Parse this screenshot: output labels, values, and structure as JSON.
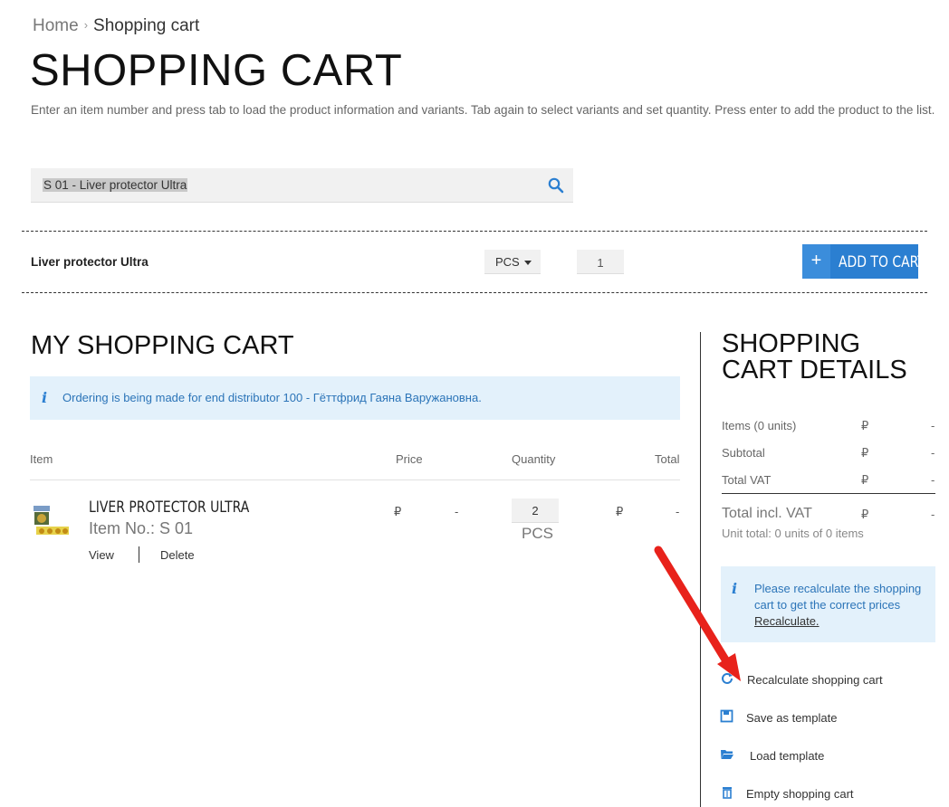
{
  "breadcrumb": {
    "home": "Home",
    "separator": "›",
    "current": "Shopping cart"
  },
  "page": {
    "title": "SHOPPING CART",
    "intro": "Enter an item number and press tab to load the product information and variants. Tab again to select variants and set quantity. Press enter to add the product to the list."
  },
  "search": {
    "value": "S 01 - Liver protector Ultra",
    "icon": "search-icon"
  },
  "quick_add": {
    "product_name": "Liver protector Ultra",
    "unit": "PCS",
    "quantity": "1",
    "add_plus": "+",
    "add_label": "ADD TO CART"
  },
  "my_cart": {
    "title": "MY SHOPPING CART",
    "info_icon": "i",
    "info_text": "Ordering is being made for end distributor 100 - Гёттфрид Гаяна Варужановна.",
    "columns": {
      "item": "Item",
      "price": "Price",
      "quantity": "Quantity",
      "total": "Total"
    },
    "items": [
      {
        "name": "LIVER PROTECTOR ULTRA",
        "item_no": "Item No.: S 01",
        "price_currency": "₽",
        "price_value": "-",
        "quantity": "2",
        "unit": "PCS",
        "total_currency": "₽",
        "total_value": "-",
        "view_label": "View",
        "delete_label": "Delete"
      }
    ]
  },
  "details": {
    "title_line1": "SHOPPING",
    "title_line2": "CART DETAILS",
    "rows": [
      {
        "label": "Items (0 units)",
        "currency": "₽",
        "value": "-"
      },
      {
        "label": "Subtotal",
        "currency": "₽",
        "value": "-"
      },
      {
        "label": "Total VAT",
        "currency": "₽",
        "value": "-"
      }
    ],
    "total": {
      "label": "Total incl. VAT",
      "currency": "₽",
      "value": "-"
    },
    "unit_total": "Unit total: 0 units of 0 items",
    "recalc_notice": "Please recalculate the shopping cart to get the correct prices",
    "recalc_link": "Recalculate.",
    "actions": [
      {
        "label": "Recalculate shopping cart",
        "icon": "refresh-icon"
      },
      {
        "label": "Save as template",
        "icon": "floppy-disk-icon"
      },
      {
        "label": "Load template",
        "icon": "folder-open-icon"
      },
      {
        "label": "Empty shopping cart",
        "icon": "trash-icon"
      }
    ]
  },
  "colors": {
    "accent": "#2b7fd1",
    "info_bg": "#e3f1fb",
    "info_text": "#2b74b8",
    "annotation_arrow": "#e8221b"
  }
}
